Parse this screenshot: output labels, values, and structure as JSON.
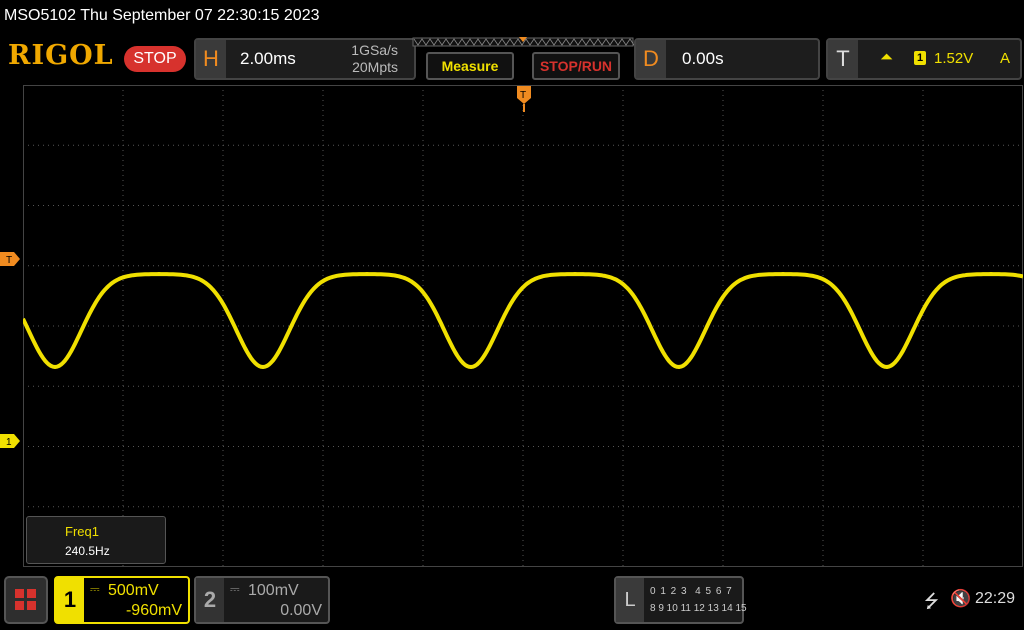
{
  "title_bar": {
    "text": "MSO5102  Thu September 07 22:30:15 2023"
  },
  "header": {
    "logo": "RIGOL",
    "run_state": "STOP",
    "horizontal": {
      "letter": "H",
      "timebase": "2.00ms",
      "sample_rate": "1GSa/s",
      "memory_depth": "20Mpts"
    },
    "measure_label": "Measure",
    "stop_run_label": "STOP/RUN",
    "delay": {
      "letter": "D",
      "value": "0.00s"
    },
    "trigger": {
      "letter": "T",
      "edge_icon": "rising-edge-icon",
      "edge_glyph": "⏶",
      "source": "1",
      "level": "1.52V",
      "mode": "A"
    }
  },
  "scope": {
    "ch1_marker": "1",
    "trigger_marker": "T",
    "waveform": {
      "color": "#f0e000",
      "frequency_hz": 240.5
    }
  },
  "measurement": {
    "name": "Freq1",
    "value": "240.5Hz"
  },
  "channels": [
    {
      "number": "1",
      "coupling_glyph": "⎓",
      "scale": "500mV",
      "offset": "-960mV",
      "color": "#f0e000",
      "active": true
    },
    {
      "number": "2",
      "coupling_glyph": "⎓",
      "scale": "100mV",
      "offset": "0.00V",
      "color": "#aaaaaa",
      "active": false
    }
  ],
  "logic": {
    "letter": "L",
    "row1": "0 1 2 3  4 5 6 7",
    "row2": "8 9 10 11 12 13 14 15"
  },
  "status": {
    "usb_glyph": "⭍",
    "mute_glyph": "🔇",
    "time": "22:29"
  }
}
